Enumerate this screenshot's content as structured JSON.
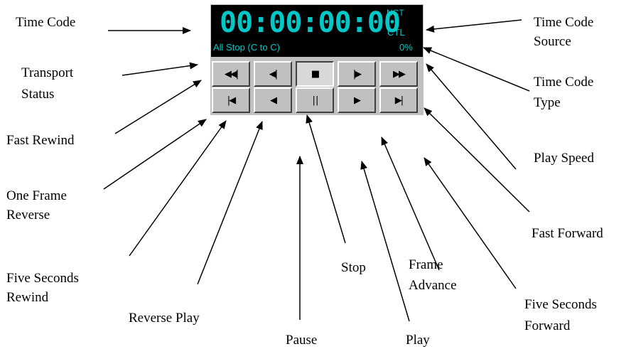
{
  "labels": {
    "time_code": "Time Code",
    "transport_status": [
      "Transport",
      "Status"
    ],
    "fast_rewind": "Fast Rewind",
    "one_frame_reverse": [
      "One Frame",
      "Reverse"
    ],
    "five_seconds_rewind": [
      "Five Seconds",
      "Rewind"
    ],
    "reverse_play": "Reverse Play",
    "pause": "Pause",
    "stop": "Stop",
    "play": "Play",
    "frame_advance": [
      "Frame",
      "Advance"
    ],
    "five_seconds_forward": [
      "Five Seconds",
      "Forward"
    ],
    "fast_forward": "Fast Forward",
    "play_speed": "Play Speed",
    "time_code_type": [
      "Time Code",
      "Type"
    ],
    "time_code_source": [
      "Time Code",
      "Source"
    ]
  },
  "display": {
    "time_code": "00:00:00:00",
    "source": "NCT",
    "type": "CTL",
    "status": "All Stop (C to C)",
    "speed": "0%"
  },
  "buttons": {
    "row1": [
      {
        "name": "fast-rewind-button",
        "icon": "fast-rewind-icon",
        "glyph": "◀◀|"
      },
      {
        "name": "one-frame-reverse-button",
        "icon": "frame-reverse-icon",
        "glyph": "◀|"
      },
      {
        "name": "stop-button",
        "icon": "stop-icon",
        "glyph": "■"
      },
      {
        "name": "frame-advance-button",
        "icon": "frame-advance-icon",
        "glyph": "|▶"
      },
      {
        "name": "fast-forward-button",
        "icon": "fast-forward-icon",
        "glyph": "▶▶"
      }
    ],
    "row2": [
      {
        "name": "five-seconds-rewind-button",
        "icon": "skip-back-icon",
        "glyph": "|◀"
      },
      {
        "name": "reverse-play-button",
        "icon": "reverse-play-icon",
        "glyph": "◀"
      },
      {
        "name": "pause-button",
        "icon": "pause-icon",
        "glyph": "| |"
      },
      {
        "name": "play-button",
        "icon": "play-icon",
        "glyph": "▶"
      },
      {
        "name": "five-seconds-forward-button",
        "icon": "skip-forward-icon",
        "glyph": "▶|"
      }
    ]
  },
  "colors": {
    "display_bg": "#000000",
    "display_text": "#00c8c8",
    "panel": "#c0c0c0"
  }
}
